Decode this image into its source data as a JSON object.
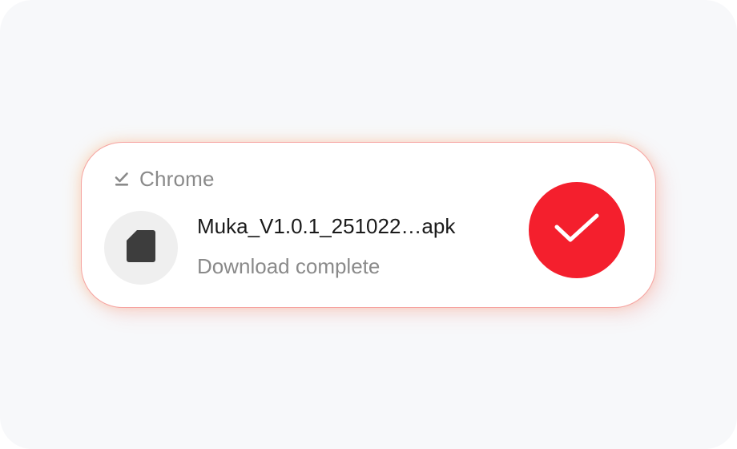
{
  "notification": {
    "app_name": "Chrome",
    "app_icon": "download-check-icon",
    "file_icon": "file-icon",
    "file_name": "Muka_V1.0.1_251022…apk",
    "status": "Download complete",
    "action_icon": "checkmark-icon"
  },
  "colors": {
    "background": "#f7f8fa",
    "card": "#ffffff",
    "card_border": "#f6a3a0",
    "accent": "#f41f2d",
    "secondary_text": "#8a8a8a",
    "primary_text": "#1a1a1a",
    "file_icon": "#3d3d3d",
    "file_icon_bg": "#efefef"
  }
}
